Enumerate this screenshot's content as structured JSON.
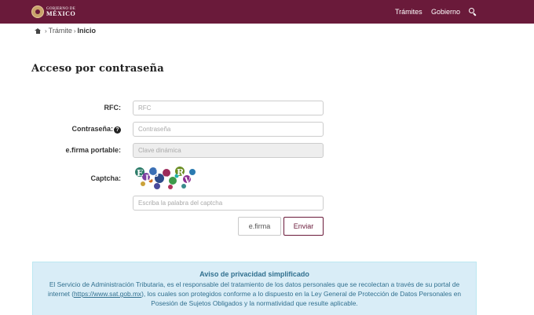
{
  "header": {
    "logo_line1": "GOBIERNO DE",
    "logo_line2": "MÉXICO",
    "nav": [
      "Trámites",
      "Gobierno"
    ],
    "brand_color": "#6a1a3a"
  },
  "breadcrumb": {
    "home_icon": "home-icon",
    "separator": "›",
    "items": [
      "Trámite",
      "Inicio"
    ]
  },
  "page": {
    "title": "Acceso por contraseña"
  },
  "form": {
    "rfc": {
      "label": "RFC:",
      "placeholder": "RFC"
    },
    "password": {
      "label": "Contraseña:",
      "help": "?",
      "placeholder": "Contraseña"
    },
    "efirma_portable": {
      "label": "e.firma portable:",
      "placeholder": "Clave dinámica"
    },
    "captcha": {
      "label": "Captcha:",
      "placeholder": "Escriba la palabra del captcha"
    },
    "buttons": {
      "efirma": "e.firma",
      "enviar": "Enviar"
    }
  },
  "privacy": {
    "title": "Aviso de privacidad simplificado",
    "text_before_link": "El Servicio de Administración Tributaria, es el responsable del tratamiento de los datos personales que se recolectan a través de su portal de internet (",
    "link": "https://www.sat.gob.mx",
    "text_after_link": "), los cuales son protegidos conforme a lo dispuesto en la Ley General de Protección de Datos Personales en Posesión de Sujetos Obligados y la normatividad que resulte aplicable."
  }
}
